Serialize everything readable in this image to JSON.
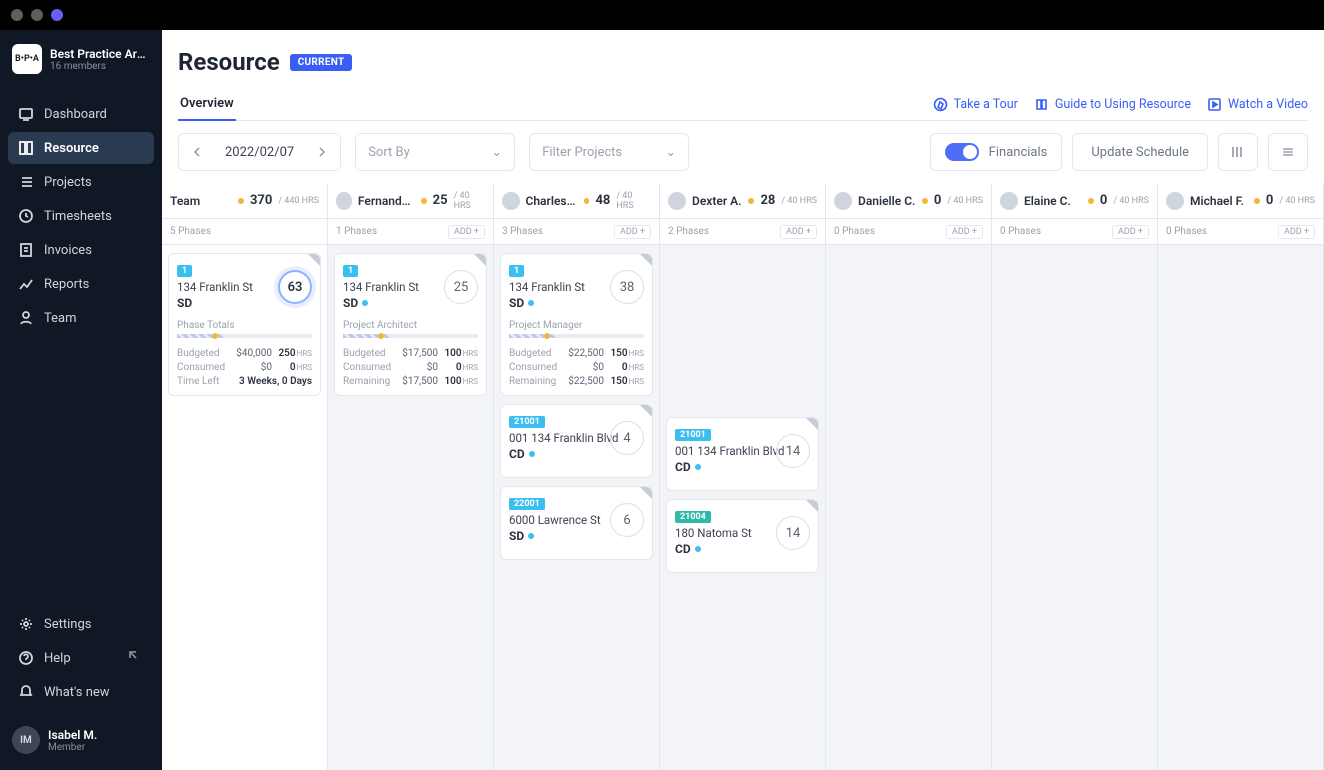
{
  "org": {
    "logo": "B•P•A",
    "name": "Best Practice Arch...",
    "members": "16 members"
  },
  "nav": {
    "dashboard": "Dashboard",
    "resource": "Resource",
    "projects": "Projects",
    "timesheets": "Timesheets",
    "invoices": "Invoices",
    "reports": "Reports",
    "team": "Team",
    "settings": "Settings",
    "help": "Help",
    "whatsnew": "What's new"
  },
  "user": {
    "initials": "IM",
    "name": "Isabel M.",
    "role": "Member"
  },
  "page": {
    "title": "Resource",
    "badge": "CURRENT"
  },
  "tabs": {
    "overview": "Overview"
  },
  "links": {
    "tour": "Take a Tour",
    "guide": "Guide to Using Resource",
    "video": "Watch a Video"
  },
  "controls": {
    "date": "2022/02/07",
    "sort": "Sort By",
    "filter": "Filter Projects",
    "financials": "Financials",
    "update": "Update Schedule"
  },
  "columns": [
    {
      "name": "Team",
      "hours": "370",
      "cap": "/ 440 HRS",
      "sub": "5 Phases",
      "add": false,
      "cards": [
        {
          "badge": "1",
          "title": "134 Franklin St",
          "phase": "SD",
          "circle": "63",
          "circleActive": true,
          "role": "Phase Totals",
          "stats": [
            {
              "lbl": "Budgeted",
              "v1": "$40,000",
              "v2": "250",
              "u": "HRS"
            },
            {
              "lbl": "Consumed",
              "v1": "$0",
              "v2": "0",
              "u": "HRS"
            },
            {
              "lbl": "Time Left",
              "v1": "",
              "v2": "3 Weeks, 0 Days",
              "u": ""
            }
          ]
        }
      ]
    },
    {
      "name": "Fernando A.",
      "hours": "25",
      "cap": "/ 40 HRS",
      "sub": "1 Phases",
      "add": true,
      "cards": [
        {
          "badge": "1",
          "title": "134 Franklin St",
          "phase": "SD",
          "circle": "25",
          "circleActive": false,
          "dot": true,
          "role": "Project Architect",
          "stats": [
            {
              "lbl": "Budgeted",
              "v1": "$17,500",
              "v2": "100",
              "u": "HRS"
            },
            {
              "lbl": "Consumed",
              "v1": "$0",
              "v2": "0",
              "u": "HRS"
            },
            {
              "lbl": "Remaining",
              "v1": "$17,500",
              "v2": "100",
              "u": "HRS"
            }
          ]
        }
      ]
    },
    {
      "name": "Charles Y.",
      "hours": "48",
      "cap": "/ 40 HRS",
      "sub": "3 Phases",
      "add": true,
      "cards": [
        {
          "badge": "1",
          "title": "134 Franklin St",
          "phase": "SD",
          "circle": "38",
          "circleActive": false,
          "dot": true,
          "role": "Project Manager",
          "stats": [
            {
              "lbl": "Budgeted",
              "v1": "$22,500",
              "v2": "150",
              "u": "HRS"
            },
            {
              "lbl": "Consumed",
              "v1": "$0",
              "v2": "0",
              "u": "HRS"
            },
            {
              "lbl": "Remaining",
              "v1": "$22,500",
              "v2": "150",
              "u": "HRS"
            }
          ]
        },
        {
          "badge": "21001",
          "title": "001 134 Franklin Blvd",
          "phase": "CD",
          "circle": "4",
          "small": true,
          "dot": true
        },
        {
          "badge": "22001",
          "title": "6000 Lawrence St",
          "phase": "SD",
          "circle": "6",
          "small": true,
          "dot": true
        }
      ]
    },
    {
      "name": "Dexter A.",
      "hours": "28",
      "cap": "/ 40 HRS",
      "sub": "2 Phases",
      "add": true,
      "cards": [
        {
          "spacer": true
        },
        {
          "badge": "21001",
          "title": "001 134 Franklin Blvd",
          "phase": "CD",
          "circle": "14",
          "small": true,
          "dot": true
        },
        {
          "badge": "21004",
          "badgeTeal": true,
          "title": "180 Natoma St",
          "phase": "CD",
          "circle": "14",
          "small": true,
          "dot": true
        }
      ]
    },
    {
      "name": "Danielle C.",
      "hours": "0",
      "cap": "/ 40 HRS",
      "sub": "0 Phases",
      "add": true,
      "cards": []
    },
    {
      "name": "Elaine C.",
      "hours": "0",
      "cap": "/ 40 HRS",
      "sub": "0 Phases",
      "add": true,
      "cards": []
    },
    {
      "name": "Michael F.",
      "hours": "0",
      "cap": "/ 40 HRS",
      "sub": "0 Phases",
      "add": true,
      "cards": []
    }
  ],
  "addLabel": "ADD +"
}
